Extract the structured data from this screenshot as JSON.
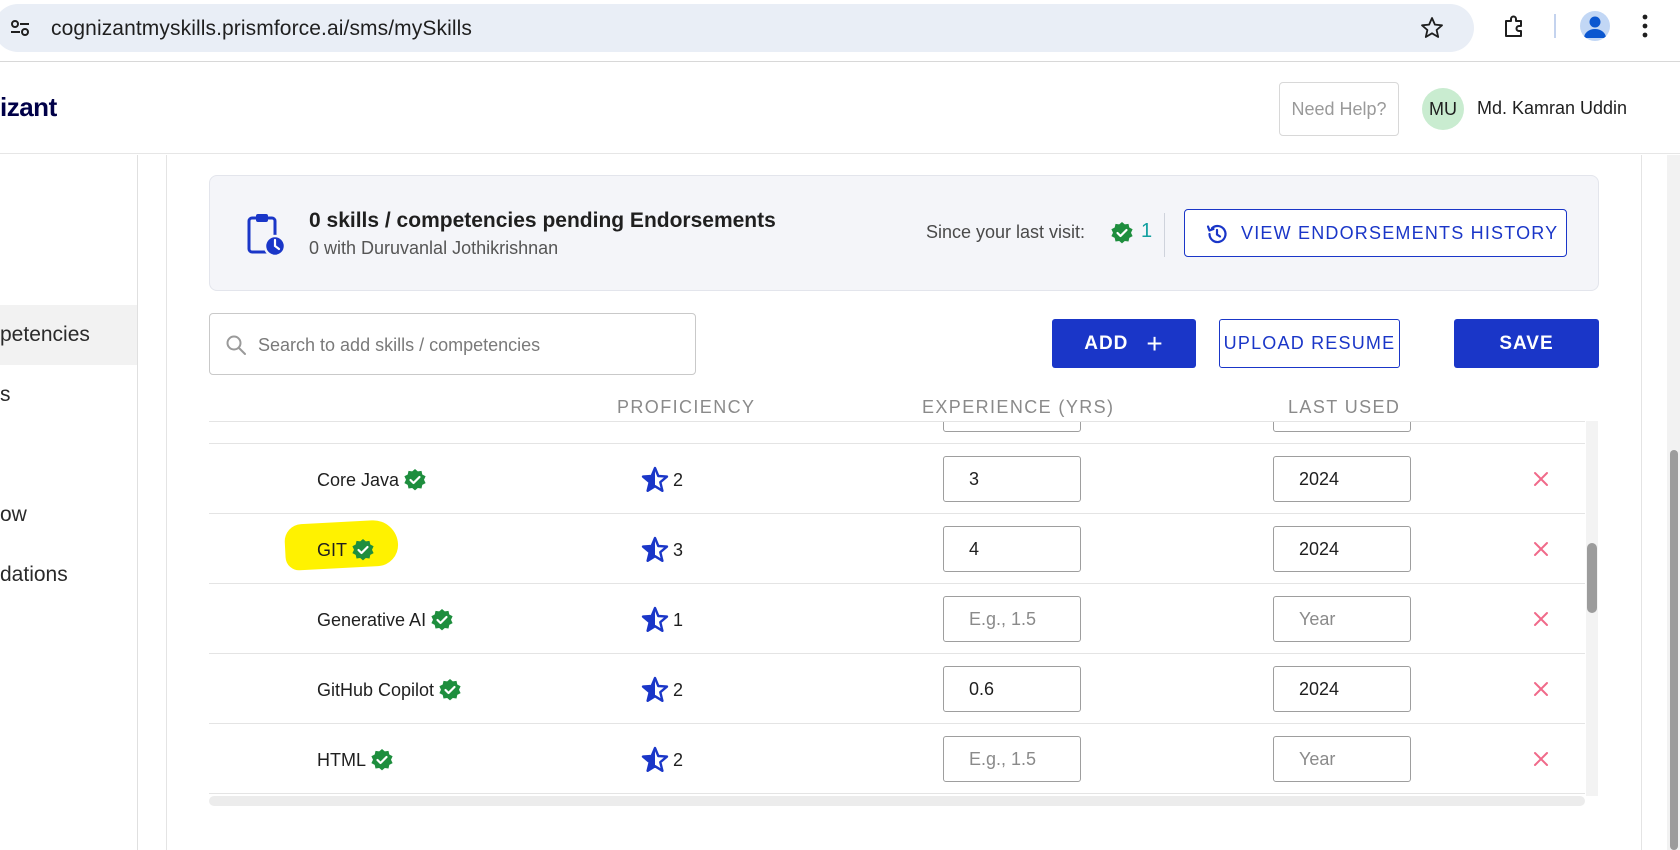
{
  "browser": {
    "url": "cognizantmyskills.prismforce.ai/sms/mySkills"
  },
  "header": {
    "logo_text": "izant",
    "help_label": "Need Help?",
    "avatar_initials": "MU",
    "user_name": "Md. Kamran Uddin"
  },
  "sidebar": {
    "items": [
      {
        "label": "petencies",
        "active": true
      },
      {
        "label": "s",
        "active": false
      },
      {
        "label": "ow",
        "active": false
      },
      {
        "label": "dations",
        "active": false
      }
    ]
  },
  "banner": {
    "title": "0 skills / competencies pending Endorsements",
    "subtitle": "0 with Duruvanlal Jothikrishnan",
    "since_label": "Since your last visit:",
    "since_count": "1",
    "history_button": "VIEW ENDORSEMENTS HISTORY"
  },
  "toolbar": {
    "search_placeholder": "Search to add skills / competencies",
    "add_label": "ADD",
    "add_icon": "+",
    "upload_label": "UPLOAD RESUME",
    "save_label": "SAVE"
  },
  "table": {
    "headers": {
      "proficiency": "PROFICIENCY",
      "experience": "EXPERIENCE (YRS)",
      "last_used": "LAST USED"
    },
    "placeholders": {
      "experience": "E.g., 1.5",
      "last_used": "Year"
    },
    "rows": [
      {
        "skill": "Core Java",
        "verified": true,
        "proficiency": "2",
        "experience": "3",
        "last_used": "2024",
        "highlighted": false
      },
      {
        "skill": "GIT",
        "verified": true,
        "proficiency": "3",
        "experience": "4",
        "last_used": "2024",
        "highlighted": true
      },
      {
        "skill": "Generative AI",
        "verified": true,
        "proficiency": "1",
        "experience": "",
        "last_used": "",
        "highlighted": false
      },
      {
        "skill": "GitHub Copilot",
        "verified": true,
        "proficiency": "2",
        "experience": "0.6",
        "last_used": "2024",
        "highlighted": false
      },
      {
        "skill": "HTML",
        "verified": true,
        "proficiency": "2",
        "experience": "",
        "last_used": "",
        "highlighted": false
      }
    ]
  },
  "colors": {
    "primary": "#1a36c8",
    "verified": "#1e8e3e",
    "delete": "#f06a8a",
    "highlight": "#fff200"
  },
  "icons": {
    "clipboard": "clipboard-clock-icon",
    "verified": "verified-badge-icon",
    "proficiency": "star-icon",
    "delete": "close-icon"
  }
}
